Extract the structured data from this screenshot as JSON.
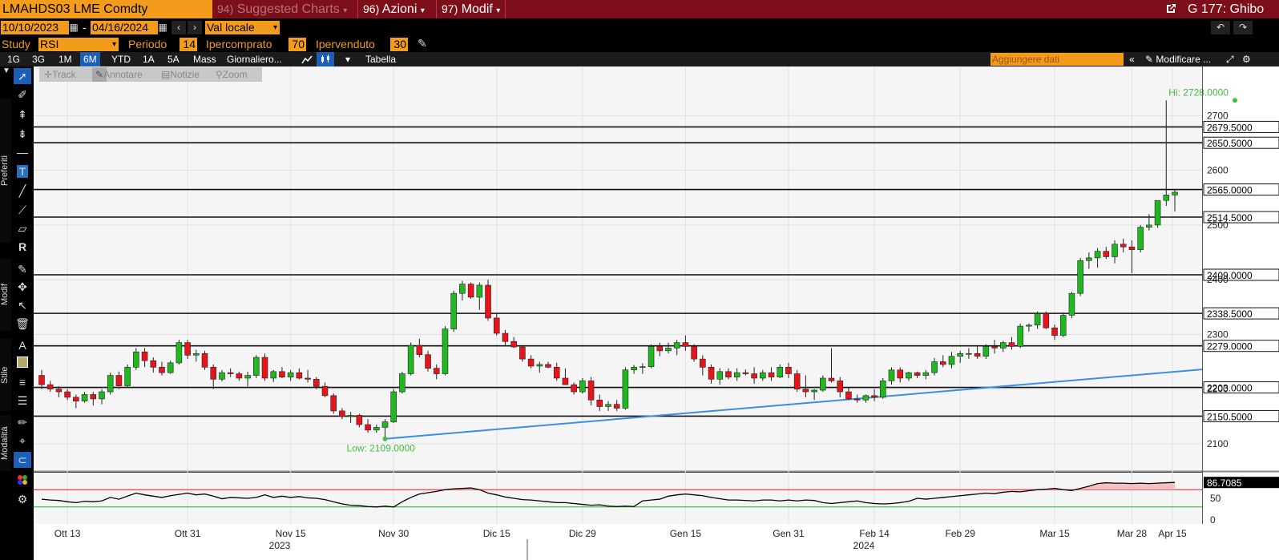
{
  "topbar": {
    "ticker": "LMAHDS03 LME Comdty",
    "suggested_num": "94)",
    "suggested": "Suggested Charts",
    "actions_num": "96)",
    "actions": "Azioni",
    "modify_num": "97)",
    "modify": "Modif",
    "right_label": "G 177: Ghibo"
  },
  "datebar": {
    "start_date": "10/10/2023",
    "separator": "-",
    "end_date": "04/16/2024",
    "currency": "Val locale"
  },
  "studybar": {
    "study_label": "Study",
    "study_value": "RSI",
    "period_label": "Periodo",
    "period_value": "14",
    "overbought_label": "Ipercomprato",
    "overbought_value": "70",
    "oversold_label": "Ipervenduto",
    "oversold_value": "30"
  },
  "tabs": [
    "1G",
    "3G",
    "1M",
    "6M",
    "YTD",
    "1A",
    "5A",
    "Mass",
    "Giornaliero..."
  ],
  "active_tab": "6M",
  "tabbar": {
    "table": "Tabella",
    "add_data_placeholder": "Aggiungere dati",
    "modify": "Modificare ..."
  },
  "chart_tools": [
    "Track",
    "Annotare",
    "Notizie",
    "Zoom"
  ],
  "sidebar": {
    "preferiti": "Preferiti",
    "modif": "Modif",
    "stile": "Stile",
    "modalita": "Modalità"
  },
  "colors": {
    "up": "#1fb81f",
    "down": "#e8131b",
    "trendline": "#3a8fe0",
    "label_green": "#3fbf3f",
    "accent": "#f39b1b",
    "topbar": "#7d0f1a"
  },
  "chart_data": {
    "type": "candlestick",
    "y_range": [
      2050,
      2790
    ],
    "y_ticks": [
      2100,
      2200,
      2300,
      2400,
      2500,
      2600,
      2700
    ],
    "x_labels": [
      "Ott 13",
      "Ott 31",
      "Nov 15",
      "Nov 30",
      "Dic 15",
      "Dic 29",
      "Gen 15",
      "Gen 31",
      "Feb 14",
      "Feb 29",
      "Mar 15",
      "Mar 28",
      "Apr 15"
    ],
    "year_labels": [
      "2023",
      "2024"
    ],
    "hi_label": "Hi: 2728.0000",
    "low_label": "Low: 2109.0000",
    "hi": 2728,
    "low": 2109,
    "levels": [
      2679.5,
      2650.5,
      2565.0,
      2514.5,
      2409.0,
      2338.5,
      2279.0,
      2203.0,
      2150.5
    ],
    "level_labels": [
      "2679.5000",
      "2650.5000",
      "2565.0000",
      "2514.5000",
      "2409.0000",
      "2338.5000",
      "2279.0000",
      "2203.0000",
      "2150.5000"
    ],
    "trendline": {
      "from": [
        "Dic 12",
        2109
      ],
      "to": [
        "Apr 18",
        2236
      ]
    },
    "ohlc": [
      [
        2225,
        2235,
        2200,
        2208
      ],
      [
        2208,
        2215,
        2195,
        2200
      ],
      [
        2200,
        2205,
        2185,
        2195
      ],
      [
        2195,
        2200,
        2180,
        2185
      ],
      [
        2185,
        2190,
        2165,
        2178
      ],
      [
        2178,
        2195,
        2175,
        2190
      ],
      [
        2190,
        2195,
        2170,
        2182
      ],
      [
        2182,
        2200,
        2172,
        2195
      ],
      [
        2195,
        2230,
        2190,
        2225
      ],
      [
        2225,
        2232,
        2200,
        2206
      ],
      [
        2206,
        2245,
        2203,
        2240
      ],
      [
        2240,
        2275,
        2235,
        2268
      ],
      [
        2268,
        2275,
        2240,
        2252
      ],
      [
        2252,
        2258,
        2230,
        2240
      ],
      [
        2240,
        2250,
        2225,
        2230
      ],
      [
        2230,
        2252,
        2228,
        2248
      ],
      [
        2248,
        2290,
        2245,
        2285
      ],
      [
        2285,
        2290,
        2255,
        2262
      ],
      [
        2262,
        2272,
        2250,
        2265
      ],
      [
        2265,
        2270,
        2235,
        2240
      ],
      [
        2240,
        2245,
        2200,
        2218
      ],
      [
        2218,
        2235,
        2214,
        2230
      ],
      [
        2230,
        2238,
        2222,
        2228
      ],
      [
        2228,
        2232,
        2215,
        2220
      ],
      [
        2220,
        2232,
        2205,
        2225
      ],
      [
        2225,
        2262,
        2220,
        2258
      ],
      [
        2258,
        2265,
        2215,
        2220
      ],
      [
        2220,
        2235,
        2213,
        2232
      ],
      [
        2232,
        2240,
        2220,
        2222
      ],
      [
        2222,
        2235,
        2215,
        2230
      ],
      [
        2230,
        2238,
        2218,
        2220
      ],
      [
        2220,
        2235,
        2212,
        2218
      ],
      [
        2218,
        2222,
        2200,
        2205
      ],
      [
        2205,
        2212,
        2185,
        2188
      ],
      [
        2188,
        2192,
        2155,
        2160
      ],
      [
        2160,
        2165,
        2145,
        2150
      ],
      [
        2150,
        2158,
        2138,
        2152
      ],
      [
        2152,
        2155,
        2130,
        2135
      ],
      [
        2135,
        2145,
        2120,
        2125
      ],
      [
        2125,
        2135,
        2120,
        2130
      ],
      [
        2130,
        2145,
        2109,
        2140
      ],
      [
        2140,
        2200,
        2138,
        2195
      ],
      [
        2195,
        2232,
        2192,
        2228
      ],
      [
        2228,
        2285,
        2225,
        2280
      ],
      [
        2280,
        2292,
        2258,
        2263
      ],
      [
        2263,
        2270,
        2232,
        2238
      ],
      [
        2238,
        2245,
        2218,
        2228
      ],
      [
        2228,
        2315,
        2225,
        2310
      ],
      [
        2310,
        2380,
        2305,
        2375
      ],
      [
        2375,
        2398,
        2362,
        2392
      ],
      [
        2392,
        2395,
        2365,
        2368
      ],
      [
        2368,
        2395,
        2345,
        2390
      ],
      [
        2390,
        2400,
        2325,
        2330
      ],
      [
        2330,
        2338,
        2298,
        2302
      ],
      [
        2302,
        2308,
        2280,
        2287
      ],
      [
        2287,
        2295,
        2275,
        2277
      ],
      [
        2277,
        2280,
        2250,
        2255
      ],
      [
        2255,
        2262,
        2238,
        2242
      ],
      [
        2242,
        2250,
        2230,
        2245
      ],
      [
        2245,
        2250,
        2238,
        2240
      ],
      [
        2240,
        2248,
        2215,
        2220
      ],
      [
        2220,
        2238,
        2212,
        2208
      ],
      [
        2208,
        2212,
        2190,
        2195
      ],
      [
        2195,
        2220,
        2192,
        2215
      ],
      [
        2215,
        2222,
        2170,
        2180
      ],
      [
        2180,
        2190,
        2160,
        2168
      ],
      [
        2168,
        2178,
        2160,
        2172
      ],
      [
        2172,
        2180,
        2160,
        2165
      ],
      [
        2165,
        2240,
        2162,
        2235
      ],
      [
        2235,
        2244,
        2228,
        2240
      ],
      [
        2240,
        2247,
        2228,
        2241
      ],
      [
        2241,
        2282,
        2238,
        2278
      ],
      [
        2278,
        2285,
        2260,
        2270
      ],
      [
        2270,
        2285,
        2265,
        2275
      ],
      [
        2275,
        2290,
        2262,
        2285
      ],
      [
        2285,
        2298,
        2270,
        2278
      ],
      [
        2278,
        2282,
        2250,
        2255
      ],
      [
        2255,
        2262,
        2225,
        2240
      ],
      [
        2240,
        2245,
        2210,
        2218
      ],
      [
        2218,
        2238,
        2208,
        2232
      ],
      [
        2232,
        2238,
        2218,
        2222
      ],
      [
        2222,
        2238,
        2215,
        2230
      ],
      [
        2230,
        2236,
        2225,
        2228
      ],
      [
        2228,
        2240,
        2210,
        2220
      ],
      [
        2220,
        2235,
        2215,
        2230
      ],
      [
        2230,
        2240,
        2215,
        2222
      ],
      [
        2222,
        2245,
        2220,
        2240
      ],
      [
        2240,
        2248,
        2220,
        2228
      ],
      [
        2228,
        2235,
        2195,
        2200
      ],
      [
        2200,
        2225,
        2185,
        2195
      ],
      [
        2195,
        2200,
        2180,
        2198
      ],
      [
        2198,
        2225,
        2195,
        2220
      ],
      [
        2220,
        2275,
        2212,
        2215
      ],
      [
        2215,
        2222,
        2185,
        2195
      ],
      [
        2195,
        2202,
        2180,
        2182
      ],
      [
        2182,
        2190,
        2175,
        2180
      ],
      [
        2180,
        2190,
        2175,
        2188
      ],
      [
        2188,
        2200,
        2178,
        2185
      ],
      [
        2185,
        2220,
        2182,
        2215
      ],
      [
        2215,
        2240,
        2208,
        2235
      ],
      [
        2235,
        2240,
        2212,
        2220
      ],
      [
        2220,
        2232,
        2215,
        2230
      ],
      [
        2230,
        2232,
        2220,
        2225
      ],
      [
        2225,
        2235,
        2218,
        2230
      ],
      [
        2230,
        2257,
        2225,
        2250
      ],
      [
        2250,
        2262,
        2240,
        2245
      ],
      [
        2245,
        2268,
        2238,
        2260
      ],
      [
        2260,
        2270,
        2248,
        2265
      ],
      [
        2265,
        2275,
        2255,
        2265
      ],
      [
        2265,
        2278,
        2255,
        2260
      ],
      [
        2260,
        2282,
        2255,
        2278
      ],
      [
        2278,
        2290,
        2265,
        2275
      ],
      [
        2275,
        2288,
        2268,
        2285
      ],
      [
        2285,
        2295,
        2272,
        2278
      ],
      [
        2278,
        2320,
        2275,
        2315
      ],
      [
        2315,
        2320,
        2305,
        2317
      ],
      [
        2317,
        2342,
        2310,
        2338
      ],
      [
        2338,
        2342,
        2310,
        2312
      ],
      [
        2312,
        2318,
        2290,
        2298
      ],
      [
        2298,
        2340,
        2295,
        2335
      ],
      [
        2335,
        2378,
        2330,
        2375
      ],
      [
        2375,
        2440,
        2370,
        2435
      ],
      [
        2435,
        2450,
        2420,
        2440
      ],
      [
        2440,
        2458,
        2422,
        2452
      ],
      [
        2452,
        2460,
        2438,
        2442
      ],
      [
        2442,
        2472,
        2430,
        2465
      ],
      [
        2465,
        2475,
        2450,
        2460
      ],
      [
        2460,
        2472,
        2412,
        2455
      ],
      [
        2455,
        2500,
        2450,
        2496
      ],
      [
        2496,
        2520,
        2490,
        2500
      ],
      [
        2500,
        2530,
        2495,
        2545
      ],
      [
        2545,
        2728,
        2535,
        2555
      ],
      [
        2555,
        2565,
        2525,
        2560
      ]
    ],
    "rsi": {
      "value_label": "86.7085",
      "ticks": [
        50,
        0
      ],
      "overbought": 70,
      "oversold": 30,
      "values": [
        48,
        46,
        45,
        42,
        40,
        43,
        42,
        44,
        52,
        48,
        55,
        62,
        58,
        55,
        52,
        56,
        62,
        58,
        60,
        55,
        49,
        52,
        51,
        50,
        52,
        58,
        52,
        55,
        52,
        54,
        51,
        50,
        47,
        42,
        37,
        34,
        33,
        31,
        30,
        32,
        30,
        42,
        52,
        60,
        63,
        66,
        70,
        72,
        74,
        70,
        62,
        58,
        53,
        50,
        47,
        46,
        44,
        42,
        40,
        40,
        38,
        36,
        34,
        35,
        32,
        31,
        32,
        31,
        44,
        46,
        48,
        55,
        58,
        60,
        58,
        56,
        52,
        49,
        46,
        46,
        44,
        46,
        46,
        44,
        46,
        44,
        46,
        45,
        40,
        38,
        40,
        42,
        44,
        40,
        38,
        37,
        38,
        40,
        43,
        50,
        48,
        50,
        52,
        54,
        56,
        58,
        60,
        62,
        61,
        64,
        66,
        65,
        70,
        71,
        73,
        70,
        68,
        73,
        78,
        84,
        86,
        85,
        85,
        84,
        85,
        84,
        85,
        86,
        86.7
      ]
    }
  }
}
